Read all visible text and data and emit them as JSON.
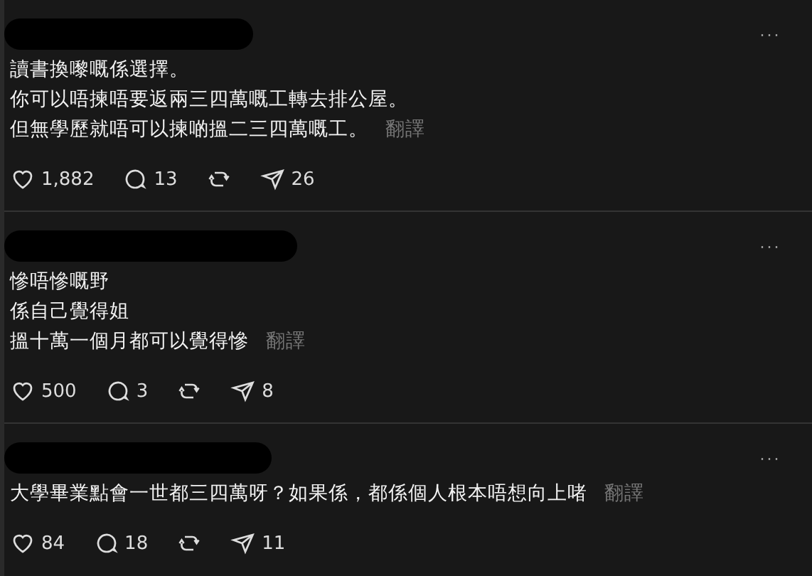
{
  "posts": [
    {
      "lines": [
        "讀書換嚟嘅係選擇。",
        "你可以唔揀唔要返兩三四萬嘅工轉去排公屋。",
        "但無學歷就唔可以揀啲搵二三四萬嘅工。"
      ],
      "translate": "翻譯",
      "likes": "1,882",
      "replies": "13",
      "shares": "26",
      "more": "···"
    },
    {
      "lines": [
        "慘唔慘嘅野",
        "係自己覺得姐",
        "搵十萬一個月都可以覺得慘"
      ],
      "translate": "翻譯",
      "likes": "500",
      "replies": "3",
      "shares": "8",
      "more": "···"
    },
    {
      "lines": [
        "大學畢業點會一世都三四萬呀？如果係，都係個人根本唔想向上啫"
      ],
      "translate": "翻譯",
      "likes": "84",
      "replies": "18",
      "shares": "11",
      "more": "···"
    }
  ]
}
